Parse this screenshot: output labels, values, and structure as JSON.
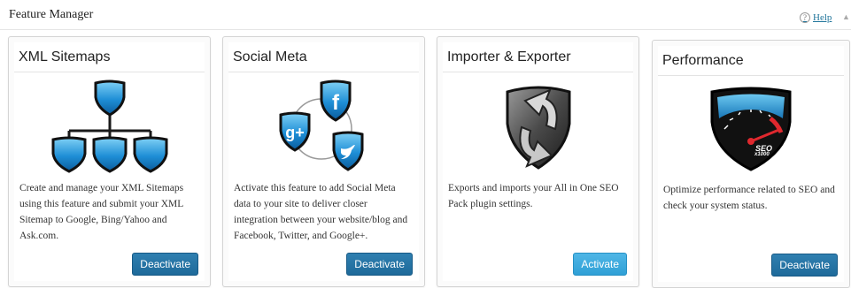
{
  "header": {
    "title": "Feature Manager",
    "help_label": "Help",
    "help_icon": "?",
    "collapse_icon": "▲"
  },
  "colors": {
    "deactivate_button": "#1e6a9a",
    "activate_button": "#2fa0d6",
    "link": "#21759b"
  },
  "cards": [
    {
      "title": "XML Sitemaps",
      "icon": "sitemap-shields-icon",
      "description": "Create and manage your XML Sitemaps using this feature and submit your XML Sitemap to Google, Bing/Yahoo and Ask.com.",
      "button_label": "Deactivate",
      "status": "active"
    },
    {
      "title": "Social Meta",
      "icon": "social-shields-icon",
      "description": "Activate this feature to add Social Meta data to your site to deliver closer integration between your website/blog and Facebook, Twitter, and Google+.",
      "button_label": "Deactivate",
      "status": "active"
    },
    {
      "title": "Importer & Exporter",
      "icon": "import-export-shield-icon",
      "description": "Exports and imports your All in One SEO Pack plugin settings.",
      "button_label": "Activate",
      "status": "inactive"
    },
    {
      "title": "Performance",
      "icon": "seo-gauge-icon",
      "gauge_text": "SEO",
      "gauge_subtext": "x1000",
      "description": "Optimize performance related to SEO and check your system status.",
      "button_label": "Deactivate",
      "status": "active"
    }
  ]
}
